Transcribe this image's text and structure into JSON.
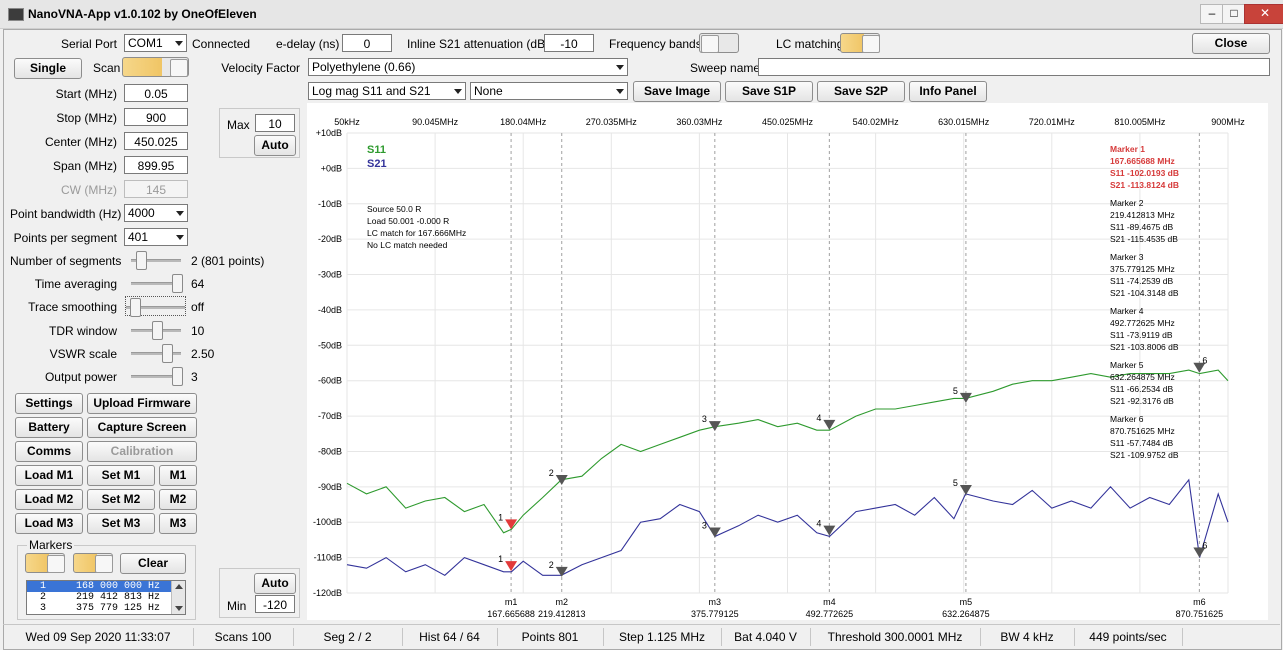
{
  "window": {
    "title": "NanoVNA-App v1.0.102 by OneOfEleven",
    "minimize": "–",
    "maximize": "□",
    "close": "✕"
  },
  "top": {
    "serial_port_label": "Serial Port",
    "serial_port_value": "COM1",
    "connected": "Connected",
    "edelay_label": "e-delay (ns)",
    "edelay_value": "0",
    "atten_label": "Inline S21 attenuation (dB)",
    "atten_value": "-10",
    "freq_bands_label": "Frequency bands",
    "lc_matching_label": "LC matching",
    "close_button": "Close",
    "velocity_label": "Velocity Factor",
    "velocity_value": "Polyethylene (0.66)",
    "sweep_name_label": "Sweep name",
    "sweep_name_value": "",
    "trace_select": "Log mag S11 and S21",
    "trace_select2": "None",
    "save_image": "Save Image",
    "save_s1p": "Save S1P",
    "save_s2p": "Save S2P",
    "info_panel": "Info Panel"
  },
  "left": {
    "single": "Single",
    "scan": "Scan",
    "start_label": "Start (MHz)",
    "start": "0.05",
    "stop_label": "Stop (MHz)",
    "stop": "900",
    "center_label": "Center (MHz)",
    "center": "450.025",
    "span_label": "Span (MHz)",
    "span": "899.95",
    "cw_label": "CW (MHz)",
    "cw": "145",
    "pbw_label": "Point bandwidth (Hz)",
    "pbw": "4000",
    "pps_label": "Points per segment",
    "pps": "401",
    "segments_label": "Number of segments",
    "segments_value": "2 (801 points)",
    "avg_label": "Time averaging",
    "avg_value": "64",
    "smooth_label": "Trace smoothing",
    "smooth_value": "off",
    "tdr_label": "TDR window",
    "tdr_value": "10",
    "vswr_label": "VSWR scale",
    "vswr_value": "2.50",
    "power_label": "Output power",
    "power_value": "3",
    "settings": "Settings",
    "upload": "Upload Firmware",
    "battery": "Battery",
    "capture": "Capture Screen",
    "comms": "Comms",
    "calibration": "Calibration",
    "load_m1": "Load M1",
    "set_m1": "Set M1",
    "m1": "M1",
    "load_m2": "Load M2",
    "set_m2": "Set M2",
    "m2": "M2",
    "load_m3": "Load M3",
    "set_m3": "Set M3",
    "m3": "M3",
    "markers_label": "Markers",
    "clear": "Clear",
    "marker_list": [
      "1     168 000 000 Hz",
      "2     219 412 813 Hz",
      "3     375 779 125 Hz"
    ],
    "max_label": "Max",
    "max_value": "10",
    "auto_top": "Auto",
    "auto_bottom": "Auto",
    "min_label": "Min",
    "min_value": "-120"
  },
  "chart_data": {
    "type": "line",
    "x_tick_labels": [
      "50kHz",
      "90.045MHz",
      "180.04MHz",
      "270.035MHz",
      "360.03MHz",
      "450.025MHz",
      "540.02MHz",
      "630.015MHz",
      "720.01MHz",
      "810.005MHz",
      "900MHz"
    ],
    "y_tick_labels": [
      "+10dB",
      "+0dB",
      "-10dB",
      "-20dB",
      "-30dB",
      "-40dB",
      "-50dB",
      "-60dB",
      "-70dB",
      "-80dB",
      "-90dB",
      "-100dB",
      "-110dB",
      "-120dB"
    ],
    "xlim": [
      0.05,
      900
    ],
    "ylim": [
      -120,
      10
    ],
    "colors": {
      "S11": "#2e9a2e",
      "S21": "#33339a",
      "marker_active": "#e23a3a",
      "marker_text": "#d63a3a"
    },
    "series": [
      {
        "name": "S11",
        "x": [
          0.05,
          20,
          40,
          60,
          80,
          100,
          120,
          140,
          160,
          168,
          180,
          200,
          219,
          240,
          260,
          280,
          300,
          320,
          340,
          360,
          376,
          400,
          420,
          440,
          460,
          480,
          493,
          520,
          540,
          560,
          580,
          600,
          620,
          632,
          660,
          680,
          700,
          720,
          740,
          760,
          780,
          800,
          820,
          840,
          860,
          871,
          890,
          900
        ],
        "y": [
          -89,
          -92,
          -90,
          -96,
          -94,
          -93,
          -97,
          -95,
          -103,
          -102,
          -98,
          -93,
          -88,
          -87,
          -82,
          -78,
          -80,
          -78,
          -76,
          -74,
          -73,
          -72,
          -71,
          -73,
          -72,
          -74,
          -74,
          -70,
          -68,
          -68,
          -67,
          -66,
          -65,
          -65,
          -63,
          -61,
          -60,
          -60,
          -59,
          -58,
          -59,
          -58,
          -58,
          -58,
          -57,
          -58,
          -57,
          -60
        ]
      },
      {
        "name": "S21",
        "x": [
          0.05,
          20,
          40,
          60,
          80,
          100,
          120,
          140,
          160,
          168,
          180,
          200,
          219,
          240,
          260,
          280,
          300,
          320,
          340,
          360,
          376,
          400,
          420,
          440,
          460,
          480,
          493,
          520,
          540,
          560,
          580,
          600,
          620,
          632,
          660,
          680,
          700,
          720,
          740,
          760,
          780,
          800,
          820,
          840,
          860,
          871,
          890,
          900
        ],
        "y": [
          -112,
          -113,
          -110,
          -114,
          -112,
          -115,
          -110,
          -112,
          -114,
          -114,
          -111,
          -115,
          -115,
          -112,
          -110,
          -108,
          -100,
          -99,
          -95,
          -97,
          -104,
          -101,
          -98,
          -100,
          -98,
          -103,
          -104,
          -97,
          -96,
          -95,
          -98,
          -93,
          -99,
          -92,
          -94,
          -95,
          -91,
          -96,
          -94,
          -96,
          -90,
          -96,
          -93,
          -95,
          -88,
          -110,
          -92,
          -100
        ]
      }
    ],
    "markers": [
      {
        "id": "1",
        "x": 167.665688,
        "s11": -102.0193,
        "s21": -113.8124,
        "label": "m1",
        "freq_label": "167.665688"
      },
      {
        "id": "2",
        "x": 219.412813,
        "s11": -89.4675,
        "s21": -115.4535,
        "label": "m2",
        "freq_label": "219.412813"
      },
      {
        "id": "3",
        "x": 375.779125,
        "s11": -74.2539,
        "s21": -104.3148,
        "label": "m3",
        "freq_label": "375.779125"
      },
      {
        "id": "4",
        "x": 492.772625,
        "s11": -73.9119,
        "s21": -103.8006,
        "label": "m4",
        "freq_label": "492.772625"
      },
      {
        "id": "5",
        "x": 632.264875,
        "s11": -66.2534,
        "s21": -92.3176,
        "label": "m5",
        "freq_label": "632.264875"
      },
      {
        "id": "6",
        "x": 870.751625,
        "s11": -57.7484,
        "s21": -109.9752,
        "label": "m6",
        "freq_label": "870.751625"
      }
    ],
    "info_text": [
      "Source 50.0 R",
      "Load 50.001 -0.000 R",
      "LC match for 167.666MHz",
      "No LC match needed"
    ],
    "marker_info": [
      {
        "title": "Marker 1",
        "freq": "167.665688 MHz",
        "s11": "S11 -102.0193 dB",
        "s21": "S21 -113.8124 dB"
      },
      {
        "title": "Marker 2",
        "freq": "219.412813 MHz",
        "s11": "S11 -89.4675 dB",
        "s21": "S21 -115.4535 dB"
      },
      {
        "title": "Marker 3",
        "freq": "375.779125 MHz",
        "s11": "S11 -74.2539 dB",
        "s21": "S21 -104.3148 dB"
      },
      {
        "title": "Marker 4",
        "freq": "492.772625 MHz",
        "s11": "S11 -73.9119 dB",
        "s21": "S21 -103.8006 dB"
      },
      {
        "title": "Marker 5",
        "freq": "632.264875 MHz",
        "s11": "S11 -66.2534 dB",
        "s21": "S21 -92.3176 dB"
      },
      {
        "title": "Marker 6",
        "freq": "870.751625 MHz",
        "s11": "S11 -57.7484 dB",
        "s21": "S21 -109.9752 dB"
      }
    ]
  },
  "status": [
    "Wed 09 Sep 2020 11:33:07",
    "Scans 100",
    "Seg 2 / 2",
    "Hist 64 / 64",
    "Points 801",
    "Step 1.125 MHz",
    "Bat 4.040 V",
    "Threshold 300.0001 MHz",
    "BW 4 kHz",
    "449 points/sec"
  ]
}
